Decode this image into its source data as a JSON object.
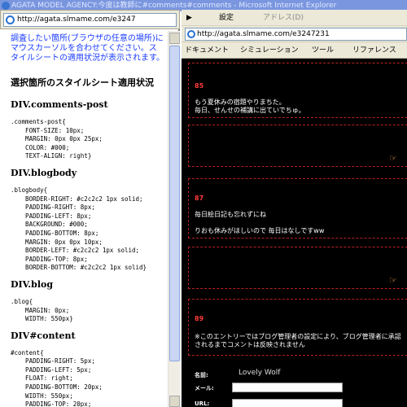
{
  "window": {
    "title": "AGATA MODEL AGENCY:今度は教師に#comments#comments - Microsoft Internet Explorer"
  },
  "popup": {
    "address": "http://agata.slmame.com/e3247",
    "notice": "調査したい箇所(ブラウザの任意の場所)にマウスカーソルを合わせてください。スタイルシートの適用状況が表示されます。",
    "heading": "選択箇所のスタイルシート適用状況",
    "rules": [
      {
        "selector": "DIV.comments-post",
        "css": ".comments-post{\n    FONT-SIZE: 10px;\n    MARGIN: 0px 0px 25px;\n    COLOR: #000;\n    TEXT-ALIGN: right}"
      },
      {
        "selector": "DIV.blogbody",
        "css": ".blogbody{\n    BORDER-RIGHT: #c2c2c2 1px solid;\n    PADDING-RIGHT: 8px;\n    PADDING-LEFT: 8px;\n    BACKGROUND: #000;\n    PADDING-BOTTOM: 8px;\n    MARGIN: 0px 0px 10px;\n    BORDER-LEFT: #c2c2c2 1px solid;\n    PADDING-TOP: 8px;\n    BORDER-BOTTOM: #c2c2c2 1px solid}"
      },
      {
        "selector": "DIV.blog",
        "css": ".blog{\n    MARGIN: 0px;\n    WIDTH: 550px}"
      },
      {
        "selector": "DIV#content",
        "css": "#content{\n    PADDING-RIGHT: 5px;\n    PADDING-LEFT: 5px;\n    FLOAT: right;\n    PADDING-BOTTOM: 20px;\n    WIDTH: 550px;\n    PADDING-TOP: 20px;"
      }
    ]
  },
  "browser": {
    "menu": {
      "sep": "▶",
      "settings": "設定",
      "address_label": "アドレス(D)"
    },
    "address": "http://agata.slmame.com/e3247231",
    "toolbar": {
      "documents": "ドキュメント",
      "simulation": "シミュレーション",
      "tools": "ツール",
      "reference": "リファレンス"
    }
  },
  "entries": [
    {
      "num": "85",
      "text": "もう夏休みの宿題やりまちた。\n毎日、せんせの補講に出ていでちゅ。"
    },
    {
      "num": "87",
      "text": "毎日絵日記も忘れずにね\n\nりおも休みがほしいので 毎日はなしですww"
    },
    {
      "num": "89",
      "text": "※このエントリーではブログ管理者の設定により、ブログ管理者に承認されるまでコメントは反映されません"
    }
  ],
  "form": {
    "name_label": "名前:",
    "name_value": "Lovely Wolf",
    "mail_label": "メール:",
    "url_label": "URL:"
  }
}
